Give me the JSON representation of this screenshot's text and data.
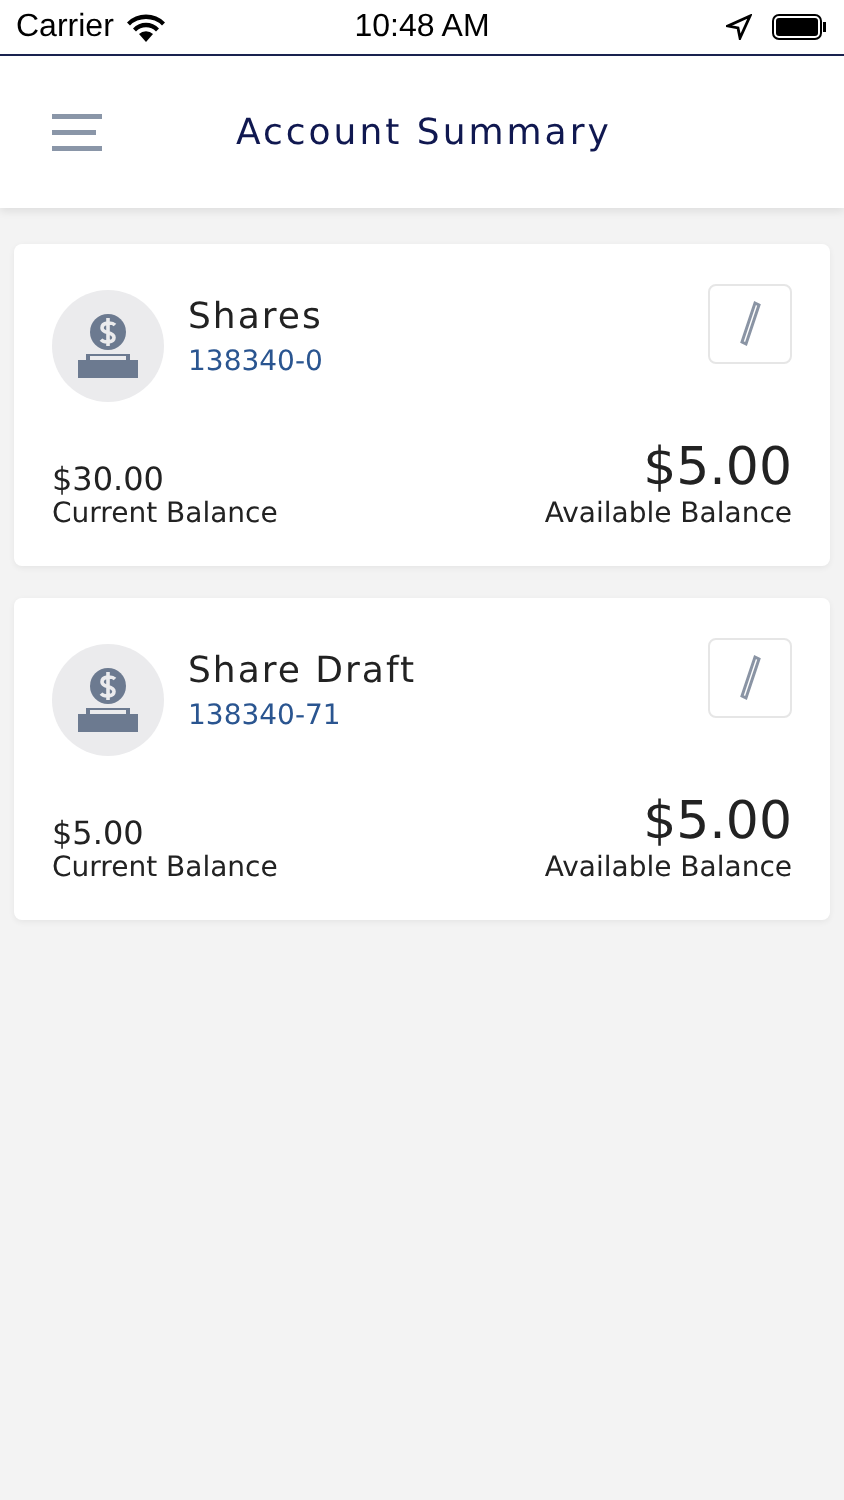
{
  "status_bar": {
    "carrier": "Carrier",
    "time": "10:48 AM"
  },
  "header": {
    "title": "Account Summary"
  },
  "accounts": [
    {
      "name": "Shares",
      "number": "138340-0",
      "current_balance": "$30.00",
      "current_label": "Current Balance",
      "available_balance": "$5.00",
      "available_label": "Available Balance"
    },
    {
      "name": "Share Draft",
      "number": "138340-71",
      "current_balance": "$5.00",
      "current_label": "Current Balance",
      "available_balance": "$5.00",
      "available_label": "Available Balance"
    }
  ]
}
